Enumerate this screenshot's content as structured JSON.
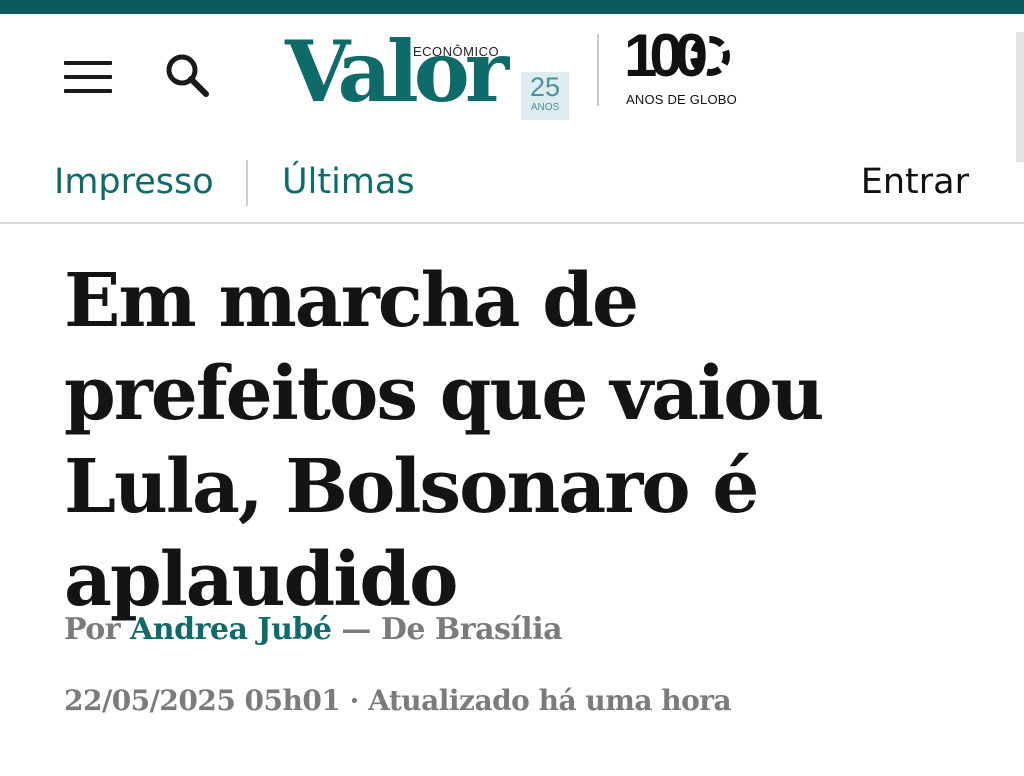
{
  "header": {
    "menu_icon": "hamburger-menu-icon",
    "search_icon": "search-icon",
    "logo": {
      "name": "Valor",
      "tagline": "ECONÔMICO",
      "anniversary_number": "25",
      "anniversary_label": "ANOS"
    },
    "globo_badge": {
      "number": "100",
      "label": "ANOS DE GLOBO"
    }
  },
  "nav": {
    "items": [
      {
        "label": "Impresso"
      },
      {
        "label": "Últimas"
      }
    ],
    "login_label": "Entrar"
  },
  "article": {
    "headline": "Em marcha de prefeitos que vaiou Lula, Bolsonaro é aplaudido",
    "byline": {
      "prefix": "Por",
      "author": "Andrea Jubé",
      "separator": "—",
      "location": "De Brasília"
    },
    "published": "22/05/2025 05h01",
    "separator_dot": "·",
    "updated": "Atualizado há uma hora"
  },
  "colors": {
    "brand": "#0f6b6a",
    "top_band": "#0b5b5c",
    "meta_text": "#7b7b7b",
    "headline_text": "#141414"
  }
}
